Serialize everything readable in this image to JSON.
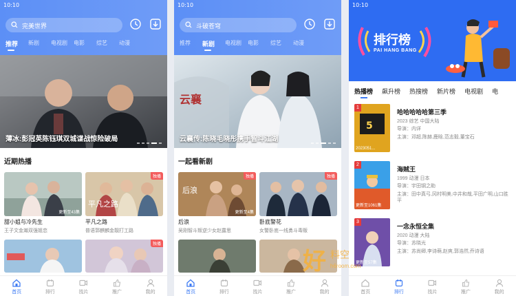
{
  "phone1": {
    "status_time": "10:10",
    "search_text": "完美世界",
    "tabs": [
      "推荐",
      "新剧",
      "电视剧",
      "电影",
      "综艺",
      "动漫"
    ],
    "banner_caption": "薄冰:彭冠英陈钰琪双城谍战惊险破局",
    "section_title": "近期热播",
    "cards": [
      {
        "title": "甜小姐与冷先生",
        "subtitle": "王子文金瀚双强姐恋",
        "episode": "更新至43集",
        "badge": ""
      },
      {
        "title": "平凡之路",
        "subtitle": "普语郭麒麟金靓打工路",
        "episode": "",
        "badge": "独播"
      },
      {
        "title": "",
        "subtitle": "",
        "episode": "",
        "badge": ""
      },
      {
        "title": "",
        "subtitle": "",
        "episode": "",
        "badge": "独播"
      }
    ]
  },
  "phone2": {
    "status_time": "10:10",
    "search_text": "斗破苍穹",
    "tabs": [
      "推荐",
      "新剧",
      "电视剧",
      "电影",
      "综艺",
      "动漫"
    ],
    "banner_caption": "云襄传:陈晓毛晓彤携手智斗江湖",
    "section_title": "一起看新剧",
    "cards": [
      {
        "title": "后浪",
        "subtitle": "吴刚智斗叛逆少女赵露思",
        "episode": "更新至4集",
        "badge": "独播"
      },
      {
        "title": "卧底警花",
        "subtitle": "女警卧底一线勇斗毒贩",
        "episode": "",
        "badge": "独播"
      },
      {
        "title": "",
        "subtitle": "",
        "episode": "",
        "badge": ""
      },
      {
        "title": "",
        "subtitle": "",
        "episode": "",
        "badge": ""
      }
    ]
  },
  "phone3": {
    "status_time": "10:10",
    "header_title": "排行榜",
    "header_sub": "PAI HANG BANG",
    "tabs": [
      "热播榜",
      "飙升榜",
      "热搜榜",
      "新片榜",
      "电视剧",
      "电"
    ],
    "items": [
      {
        "rank": "1",
        "name": "哈哈哈哈哈第三季",
        "meta": "2023  综艺  中国大陆",
        "director": "导演：内详",
        "cast": "主演：邓超,陈赫,鹿晗,范志毅,董宝石",
        "poster_caption": "2023051..."
      },
      {
        "rank": "2",
        "name": "海贼王",
        "meta": "1999  动漫  日本",
        "director": "导演：宇田钢之助",
        "cast": "主演：田中真弓,冈村明美,中井和哉,平田广明,山口胜平",
        "poster_caption": "更新至1061集"
      },
      {
        "rank": "3",
        "name": "一念永恒全集",
        "meta": "2020  动漫  大陆",
        "director": "导演：苏晓光",
        "cast": "主演：苏尚卿,李诗萌,赵爽,郭浩然,乔诗语",
        "poster_caption": "更新至57集"
      }
    ]
  },
  "nav": {
    "items": [
      "首页",
      "排行",
      "找片",
      "推广",
      "我的"
    ]
  },
  "watermark": {
    "text": "好",
    "sub": "料空",
    "url": "h6room.com"
  },
  "colors": {
    "brand_blue": "#3e7bf3",
    "header_blue": "#5c8ff6",
    "badge_red": "#f35b5b"
  }
}
